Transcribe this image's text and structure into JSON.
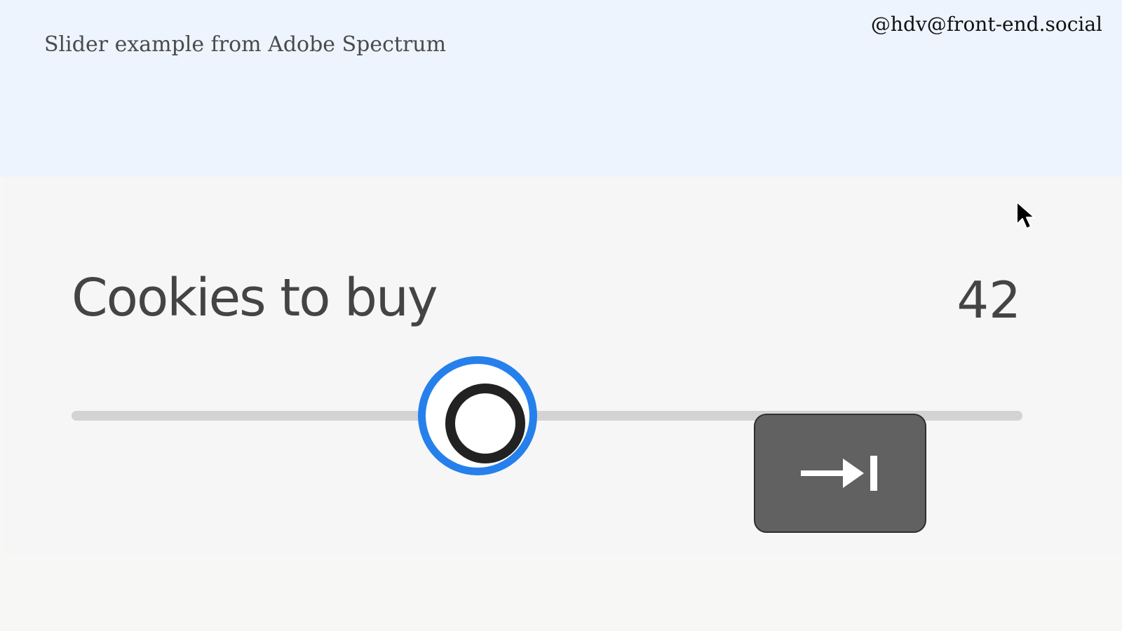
{
  "slide": {
    "title": "Slider example from Adobe Spectrum",
    "handle": "@hdv@front-end.social"
  },
  "slider": {
    "label": "Cookies to buy",
    "value": "42",
    "position_fraction": 0.42,
    "focused": true,
    "accent_color": "#2680eb"
  },
  "key_overlay": {
    "key": "Tab",
    "icon": "tab-key-icon"
  },
  "cursor": {
    "icon": "mouse-pointer-icon"
  }
}
